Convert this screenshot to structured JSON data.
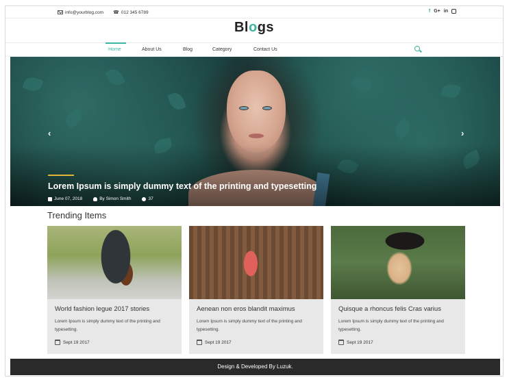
{
  "topbar": {
    "email": "info@yourblog.com",
    "phone": "012 345 6789",
    "social": {
      "facebook": "f",
      "google": "G+",
      "linkedin": "in"
    }
  },
  "logo": {
    "prefix": "Bl",
    "accent": "o",
    "suffix": "gs"
  },
  "nav": {
    "items": [
      "Home",
      "About Us",
      "Blog",
      "Category",
      "Contact Us"
    ],
    "active": "Home"
  },
  "hero": {
    "title": "Lorem Ipsum is simply dummy text of the printing and typesetting",
    "date": "June 07, 2018",
    "author": "By Simon Smith",
    "comments": "37",
    "prev_arrow": "‹",
    "next_arrow": "›"
  },
  "trending": {
    "heading": "Trending Items",
    "cards": [
      {
        "title": "World fashion legue 2017 stories",
        "desc": "Lorem Ipsum is simply dummy text of the printing and typesetting.",
        "date": "Sept 19 2017"
      },
      {
        "title": "Aenean non eros blandit maximus",
        "desc": "Lorem Ipsum is simply dummy text of the printing and typesetting.",
        "date": "Sept 19 2017"
      },
      {
        "title": "Quisque a rhoncus felis Cras varius",
        "desc": "Lorem Ipsum is simply dummy text of the printing and typesetting.",
        "date": "Sept 19 2017"
      }
    ]
  },
  "footer": {
    "text": "Design & Developed By Luzuk."
  },
  "colors": {
    "accent": "#3bb4a0",
    "hero_line": "#e0b53a",
    "footer_bg": "#2a2a2a"
  }
}
